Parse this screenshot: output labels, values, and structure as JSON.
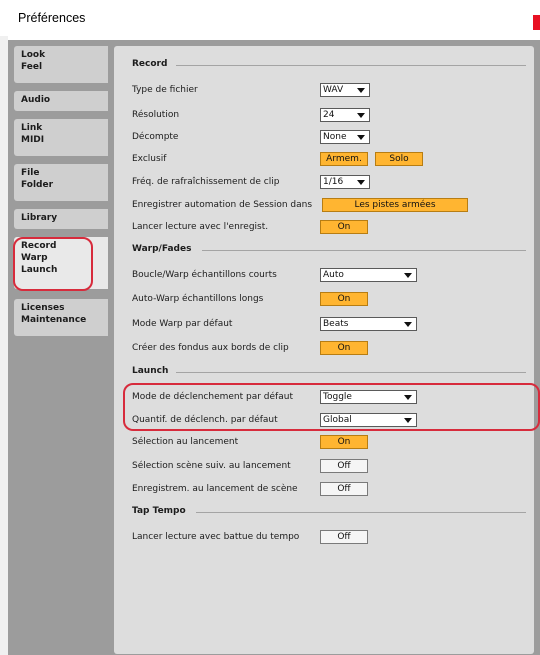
{
  "window": {
    "title": "Préférences"
  },
  "sidebar": {
    "tabs": [
      {
        "lines": [
          "Look",
          "Feel"
        ]
      },
      {
        "lines": [
          "Audio"
        ]
      },
      {
        "lines": [
          "Link",
          "MIDI"
        ]
      },
      {
        "lines": [
          "File",
          "Folder"
        ]
      },
      {
        "lines": [
          "Library"
        ]
      },
      {
        "lines": [
          "Record",
          "Warp",
          "Launch"
        ]
      },
      {
        "lines": [
          "Licenses",
          "Maintenance"
        ]
      }
    ],
    "active_tab": "Record Warp Launch"
  },
  "record": {
    "title": "Record",
    "file_type": {
      "label": "Type de fichier",
      "value": "WAV"
    },
    "resolution": {
      "label": "Résolution",
      "value": "24"
    },
    "count_in": {
      "label": "Décompte",
      "value": "None"
    },
    "exclusive": {
      "label": "Exclusif",
      "arm": "Armem.",
      "solo": "Solo"
    },
    "clip_update_rate": {
      "label": "Fréq. de rafraîchissement de clip",
      "value": "1/16"
    },
    "session_automation": {
      "label": "Enregistrer automation de Session dans",
      "value": "Les pistes armées"
    },
    "start_playback": {
      "label": "Lancer lecture avec l'enregist.",
      "value": "On"
    }
  },
  "warp": {
    "title": "Warp/Fades",
    "loop_warp_short": {
      "label": "Boucle/Warp échantillons courts",
      "value": "Auto"
    },
    "auto_warp_long": {
      "label": "Auto-Warp échantillons longs",
      "value": "On"
    },
    "default_warp_mode": {
      "label": "Mode Warp par défaut",
      "value": "Beats"
    },
    "create_fades": {
      "label": "Créer des fondus aux bords de clip",
      "value": "On"
    }
  },
  "launch": {
    "title": "Launch",
    "default_launch_mode": {
      "label": "Mode de déclenchement par défaut",
      "value": "Toggle"
    },
    "default_launch_quant": {
      "label": "Quantif. de déclench. par défaut",
      "value": "Global"
    },
    "select_on_launch": {
      "label": "Sélection au lancement",
      "value": "On"
    },
    "select_next_scene": {
      "label": "Sélection scène suiv. au lancement",
      "value": "Off"
    },
    "record_on_scene_launch": {
      "label": "Enregistrem. au lancement de scène",
      "value": "Off"
    }
  },
  "tap_tempo": {
    "title": "Tap Tempo",
    "start_playback_tap": {
      "label": "Lancer lecture avec battue du tempo",
      "value": "Off"
    }
  },
  "colors": {
    "accent_on": "#ffb531",
    "highlight": "#d72b3c",
    "panel": "#dddddd",
    "background": "#9c9c9c"
  }
}
